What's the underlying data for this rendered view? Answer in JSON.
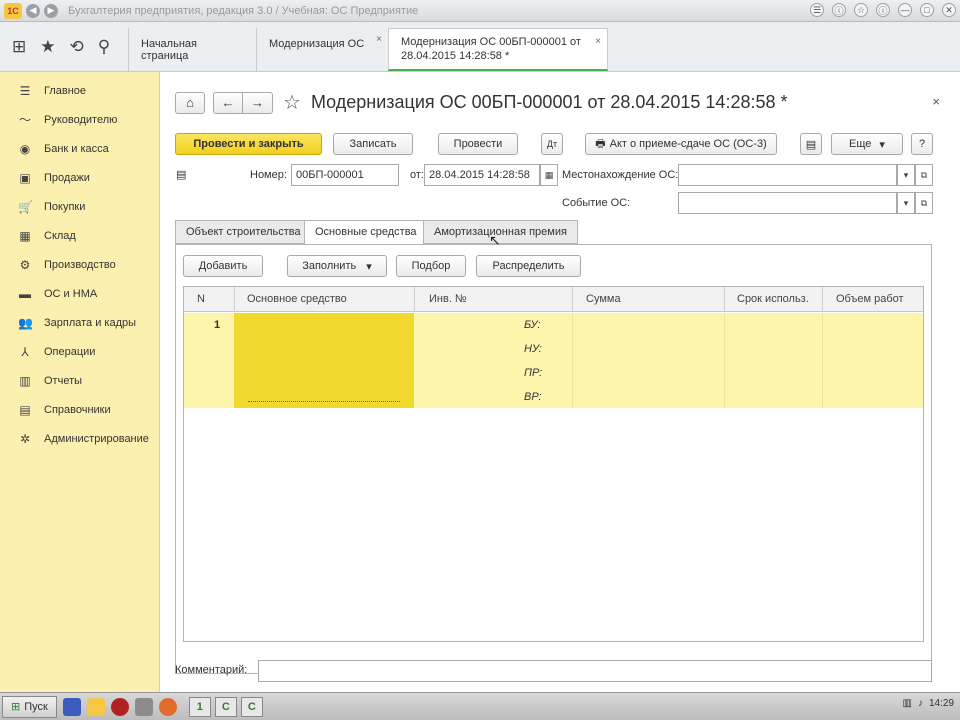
{
  "window": {
    "logo_text": "1С",
    "title": "Бухгалтерия предприятия, редакция 3.0 / Учебная: ОС Предприятие",
    "controls": [
      "◀",
      "▶",
      "☰",
      "ⓘ",
      "☆",
      "ⓘ",
      "—",
      "□",
      "✕"
    ]
  },
  "tabs": [
    {
      "label": "Начальная страница"
    },
    {
      "label": "Модернизация ОС",
      "close": "×"
    },
    {
      "label_line1": "Модернизация ОС 00БП-000001 от",
      "label_line2": "28.04.2015 14:28:58 *",
      "close": "×"
    }
  ],
  "sidebar": {
    "items": [
      {
        "label": "Главное",
        "icon": "☰"
      },
      {
        "label": "Руководителю",
        "icon": "〜"
      },
      {
        "label": "Банк и касса",
        "icon": "◉"
      },
      {
        "label": "Продажи",
        "icon": "▣"
      },
      {
        "label": "Покупки",
        "icon": "🛒"
      },
      {
        "label": "Склад",
        "icon": "▦"
      },
      {
        "label": "Производство",
        "icon": "⚙"
      },
      {
        "label": "ОС и НМА",
        "icon": "▬"
      },
      {
        "label": "Зарплата и кадры",
        "icon": "👥"
      },
      {
        "label": "Операции",
        "icon": "⅄"
      },
      {
        "label": "Отчеты",
        "icon": "▥"
      },
      {
        "label": "Справочники",
        "icon": "▤"
      },
      {
        "label": "Администрирование",
        "icon": "✲"
      }
    ]
  },
  "form": {
    "title": "Модернизация ОС 00БП-000001 от 28.04.2015 14:28:58 *",
    "close": "×",
    "buttons": {
      "post_close": "Провести и закрыть",
      "save": "Записать",
      "post": "Провести",
      "act": "Акт о приеме-сдаче ОС (ОС-3)",
      "more": "Еще",
      "more_arrow": "▾",
      "help": "?"
    },
    "fields": {
      "number_label": "Номер:",
      "number_value": "00БП-000001",
      "date_label": "от:",
      "date_value": "28.04.2015 14:28:58",
      "location_label": "Местонахождение ОС:",
      "location_value": "",
      "event_label": "Событие ОС:",
      "event_value": ""
    },
    "subtabs": [
      "Объект строительства",
      "Основные средства",
      "Амортизационная премия"
    ],
    "panel_buttons": {
      "add": "Добавить",
      "fill": "Заполнить",
      "fill_arrow": "▾",
      "pick": "Подбор",
      "distribute": "Распределить"
    },
    "table": {
      "headers": [
        "N",
        "Основное средство",
        "Инв. №",
        "Сумма",
        "Срок использ.",
        "Объем работ"
      ],
      "rows": [
        {
          "n": "1",
          "accounts": [
            "БУ:",
            "НУ:",
            "ПР:",
            "ВР:"
          ]
        }
      ]
    },
    "comment_label": "Комментарий:",
    "comment_value": ""
  },
  "taskbar": {
    "start": "Пуск",
    "time": "14:29"
  }
}
